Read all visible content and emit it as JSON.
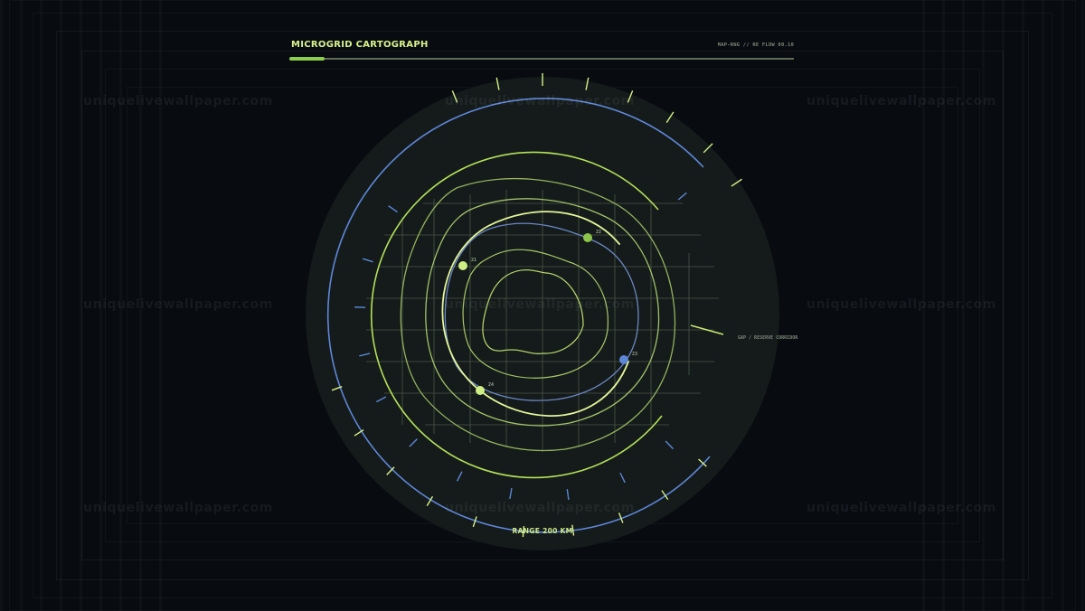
{
  "header": {
    "title": "MICROGRID CARTOGRAPH",
    "subtitle": "MAP-RNG // RE FLOW 00.10",
    "progress_fraction": 0.07
  },
  "map": {
    "nodes": [
      {
        "label": "21",
        "color": "#cfee84"
      },
      {
        "label": "22",
        "color": "#8cc44a"
      },
      {
        "label": "23",
        "color": "#5d86d6"
      },
      {
        "label": "24",
        "color": "#cfee84"
      }
    ],
    "corridor_label": "GAP / RESERVE CORRIDOR",
    "range_label": "RANGE 200 KM"
  },
  "watermark": "uniquelivewallpaper.com",
  "colors": {
    "background": "#080c11",
    "disc": "#141b1a",
    "accent_green": "#a8d85a",
    "accent_lime": "#dff58f",
    "accent_blue": "#5d86d6",
    "grid": "#4c5649"
  }
}
